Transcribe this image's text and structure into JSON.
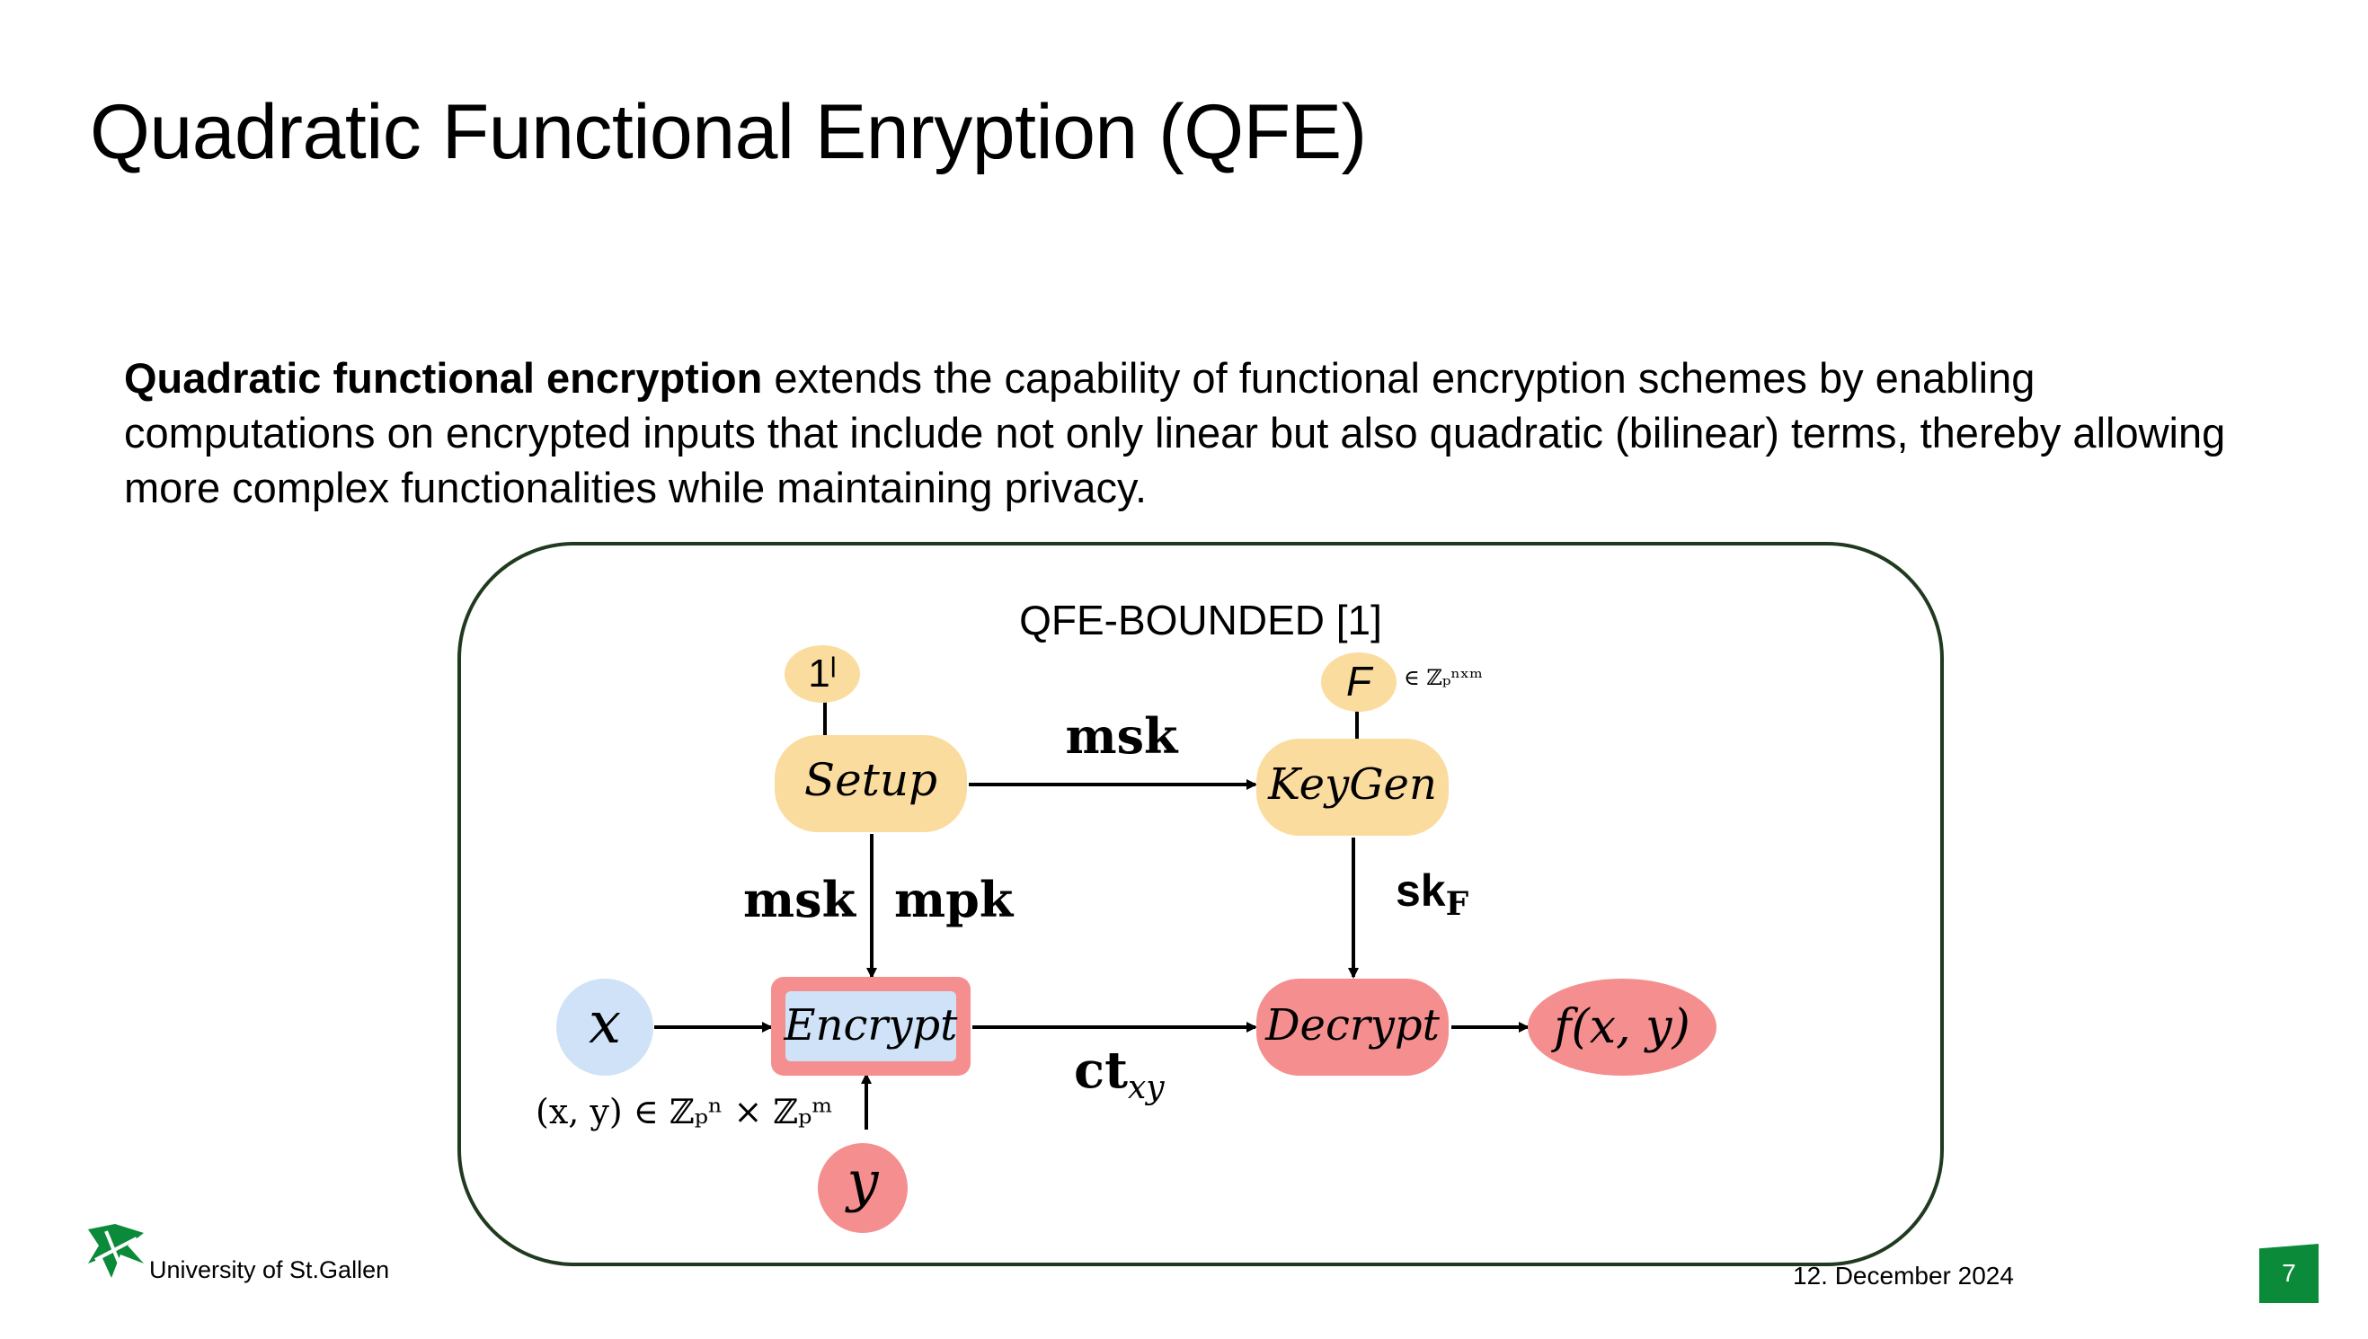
{
  "slide": {
    "title": "Quadratic Functional Enryption (QFE)",
    "intro_bold": "Quadratic functional encryption",
    "intro_rest": " extends the capability of functional encryption schemes by enabling computations on encrypted inputs that include not only linear but also quadratic (bilinear) terms, thereby allowing more complex functionalities while maintaining privacy."
  },
  "diagram": {
    "title": "QFE-BOUNDED [1]",
    "nodes": {
      "security_param": "1ˡ",
      "function_input": "F",
      "function_domain": "∈ ℤₚⁿˣᵐ",
      "setup": "Setup",
      "keygen": "KeyGen",
      "encrypt": "Encrypt",
      "decrypt": "Decrypt",
      "input_x": "x",
      "input_y": "y",
      "output": "f(x, y)",
      "input_domain": "(x, y) ∈ ℤₚⁿ × ℤₚᵐ"
    },
    "edges": {
      "setup_to_keygen": "msk",
      "setup_to_encrypt_left": "msk",
      "setup_to_encrypt_right": "mpk",
      "keygen_to_decrypt": "sk",
      "keygen_to_decrypt_sub": "F",
      "encrypt_to_decrypt": "ct",
      "encrypt_to_decrypt_sub": "xy"
    },
    "colors": {
      "setup_fill": "#fbdc9f",
      "red_fill": "#f58f8f",
      "blue_fill": "#cfe2f7",
      "frame": "#1f3a1f"
    }
  },
  "footer": {
    "university": "University of St.Gallen",
    "date": "12. December 2024",
    "page_number": "7",
    "brand_color": "#0b8a3a"
  }
}
